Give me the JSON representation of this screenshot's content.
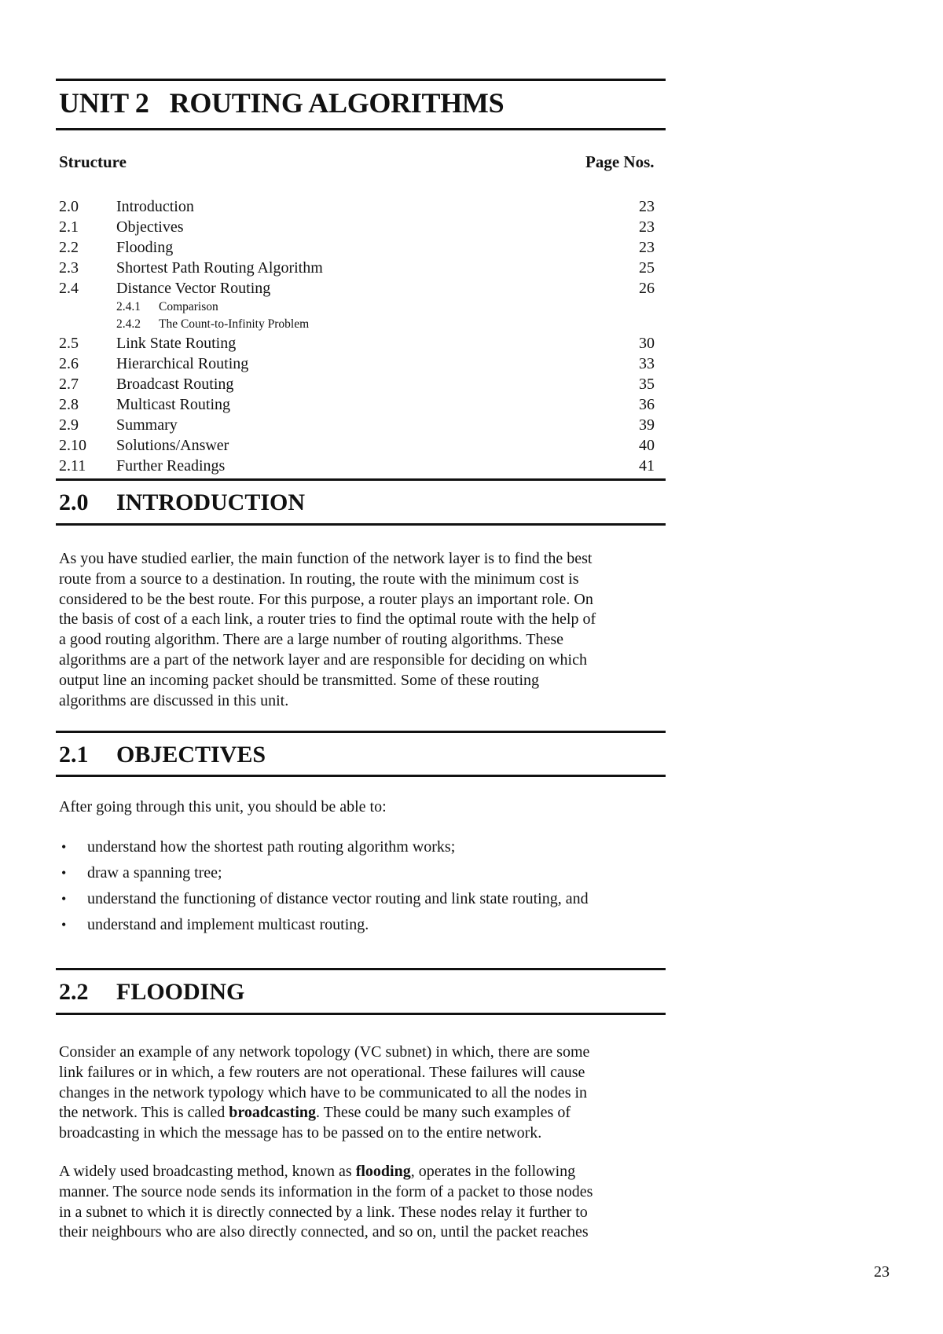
{
  "header": {
    "unit_title": "UNIT 2   ROUTING ALGORITHMS"
  },
  "structure": {
    "label": "Structure",
    "pages_label": "Page Nos.",
    "entries": [
      {
        "num": "2.0",
        "title": "Introduction",
        "page": "23",
        "level": 1
      },
      {
        "num": "2.1",
        "title": "Objectives",
        "page": "23",
        "level": 1
      },
      {
        "num": "2.2",
        "title": "Flooding",
        "page": "23",
        "level": 1
      },
      {
        "num": "2.3",
        "title": "Shortest Path Routing Algorithm",
        "page": "25",
        "level": 1
      },
      {
        "num": "2.4",
        "title": "Distance Vector Routing",
        "page": "26",
        "level": 1
      },
      {
        "num": "2.4.1",
        "title": "Comparison",
        "page": "",
        "level": 2
      },
      {
        "num": "2.4.2",
        "title": "The Count-to-Infinity Problem",
        "page": "",
        "level": 2
      },
      {
        "num": "2.5",
        "title": "Link State Routing",
        "page": "30",
        "level": 1
      },
      {
        "num": "2.6",
        "title": "Hierarchical Routing",
        "page": "33",
        "level": 1
      },
      {
        "num": "2.7",
        "title": "Broadcast Routing",
        "page": "35",
        "level": 1
      },
      {
        "num": "2.8",
        "title": "Multicast Routing",
        "page": "36",
        "level": 1
      },
      {
        "num": "2.9",
        "title": "Summary",
        "page": "39",
        "level": 1
      },
      {
        "num": "2.10",
        "title": "Solutions/Answer",
        "page": "40",
        "level": 1
      },
      {
        "num": "2.11",
        "title": "Further Readings",
        "page": "41",
        "level": 1
      }
    ]
  },
  "sections": {
    "introduction": {
      "num": "2.0",
      "title": "INTRODUCTION",
      "lines": [
        "As you have studied earlier, the main function of the network layer is to find the best",
        "route from a source to a destination. In routing, the route with the minimum cost is",
        "considered to be the best route. For this purpose, a router plays an important role. On",
        "the basis of cost of a each link, a router tries to find the optimal route with the help of",
        "a good routing algorithm. There are a large number of routing algorithms. These",
        "algorithms are a part of the network layer and are responsible for deciding on which",
        "output line an incoming packet should be transmitted. Some of these routing",
        "algorithms are discussed in this unit."
      ]
    },
    "objectives": {
      "num": "2.1",
      "title": "OBJECTIVES",
      "intro": "After going through this unit, you should be able to:",
      "bullet_symbol": "•",
      "bullets": [
        "understand how the shortest path routing algorithm works;",
        "draw a spanning tree;",
        "understand the functioning of distance vector routing and link state routing, and",
        "understand and implement multicast routing."
      ]
    },
    "flooding": {
      "num": "2.2",
      "title": "FLOODING",
      "para1": {
        "line1": "Consider an example of any network topology (VC subnet) in which, there are some",
        "line2": "link failures or in which, a few routers are not operational. These failures will cause",
        "line3": "changes in the network typology which have to be communicated to all the nodes in",
        "line4_before": "the network. This is called ",
        "line4_bold": "broadcasting",
        "line4_after": ". These could be many such examples of",
        "line5": "broadcasting in which the message has to be passed on to the entire network."
      },
      "para2": {
        "line1_before": "A widely used broadcasting method, known as ",
        "line1_bold": "flooding",
        "line1_after": ", operates in the following",
        "line2": "manner. The source node sends its information in the form of a packet to those nodes",
        "line3": "in a subnet to which it is directly connected by a link. These nodes relay it further to",
        "line4": "their neighbours who are also directly connected, and so on, until the packet reaches"
      }
    }
  },
  "footer": {
    "page_number": "23"
  }
}
